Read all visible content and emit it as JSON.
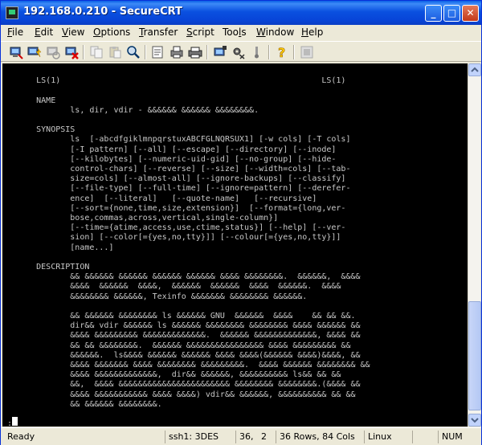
{
  "window": {
    "title": "192.168.0.210 - SecureCRT"
  },
  "titlebar_buttons": {
    "minimize": "_",
    "maximize": "□",
    "close": "✕"
  },
  "menu": [
    {
      "prefix": "",
      "u": "F",
      "rest": "ile"
    },
    {
      "prefix": "",
      "u": "E",
      "rest": "dit"
    },
    {
      "prefix": "",
      "u": "V",
      "rest": "iew"
    },
    {
      "prefix": "",
      "u": "O",
      "rest": "ptions"
    },
    {
      "prefix": "",
      "u": "T",
      "rest": "ransfer"
    },
    {
      "prefix": "",
      "u": "S",
      "rest": "cript"
    },
    {
      "prefix": "Too",
      "u": "l",
      "rest": "s"
    },
    {
      "prefix": "",
      "u": "W",
      "rest": "indow"
    },
    {
      "prefix": "",
      "u": "H",
      "rest": "elp"
    }
  ],
  "toolbar_icons": [
    "connect-icon",
    "quick-connect-icon",
    "reconnect-icon",
    "disconnect-icon",
    "copy-icon",
    "paste-icon",
    "find-icon",
    "print-setup-icon",
    "print-selection-icon",
    "print-icon",
    "session-options-icon",
    "global-options-icon",
    "keymap-icon",
    "help-icon",
    "about-icon"
  ],
  "terminal": {
    "lines": [
      "",
      "       LS(1)                                                      LS(1)",
      "",
      "       NAME",
      "              ls, dir, vdir - &&&&&& &&&&&& &&&&&&&&.",
      "",
      "       SYNOPSIS",
      "              ls  [-abcdfgiklmnpqrstuxABCFGLNQRSUX1] [-w cols] [-T cols]",
      "              [-I pattern] [--all] [--escape] [--directory] [--inode]",
      "              [--kilobytes] [--numeric-uid-gid] [--no-group] [--hide-",
      "              control-chars] [--reverse] [--size] [--width=cols] [--tab-",
      "              size=cols] [--almost-all] [--ignore-backups] [--classify]",
      "              [--file-type] [--full-time] [--ignore=pattern] [--derefer-",
      "              ence]  [--literal]   [--quote-name]   [--recursive]",
      "              [--sort={none,time,size,extension}]  [--format={long,ver-",
      "              bose,commas,across,vertical,single-column}]",
      "              [--time={atime,access,use,ctime,status}] [--help] [--ver-",
      "              sion] [--color[={yes,no,tty}]] [--colour[={yes,no,tty}]]",
      "              [name...]",
      "",
      "       DESCRIPTION",
      "              && &&&&&& &&&&&& &&&&&& &&&&&& &&&& &&&&&&&&.  &&&&&&,  &&&&",
      "              &&&&  &&&&&&  &&&&,  &&&&&&  &&&&&&  &&&&  &&&&&&.  &&&&",
      "              &&&&&&&& &&&&&&, Texinfo &&&&&&& &&&&&&&& &&&&&&.",
      "",
      "              && &&&&&& &&&&&&&& ls &&&&&& GNU  &&&&&&  &&&&    && && &&.",
      "              dir&& vdir &&&&&& ls &&&&&& &&&&&&&& &&&&&&&& &&&& &&&&&& &&",
      "              &&&& &&&&&&&&& &&&&&&&&&&&&&.  &&&&&& &&&&&&&&&&&&&, &&&& &&",
      "              && && &&&&&&&&.  &&&&&& &&&&&&&&&&&&&&&& &&&& &&&&&&&&& &&",
      "              &&&&&&.  ls&&&& &&&&&& &&&&&& &&&& &&&&(&&&&&& &&&&)&&&&, &&",
      "              &&&& &&&&&&& &&&& &&&&&&&& &&&&&&&&&.  &&&& &&&&&& &&&&&&&& &&",
      "              &&&& &&&&&&&&&&&&&,  dir&& &&&&&&, &&&&&&&&&& ls&& && &&",
      "              &&,  &&&& &&&&&&&&&&&&&&&&&&&&&&& &&&&&&&& &&&&&&&&.(&&&& &&",
      "              &&&& &&&&&&&&&&& &&&& &&&&) vdir&& &&&&&&, &&&&&&&&&& && &&",
      "              && &&&&&& &&&&&&&&.",
      "",
      " :"
    ]
  },
  "scrollbar": {
    "up": "▲",
    "down": "▼"
  },
  "status": {
    "ready": "Ready",
    "protocol": "ssh1: 3DES",
    "row": "36,",
    "col": "2",
    "size": "36 Rows,  84 Cols",
    "os": "Linux",
    "num": "NUM"
  }
}
